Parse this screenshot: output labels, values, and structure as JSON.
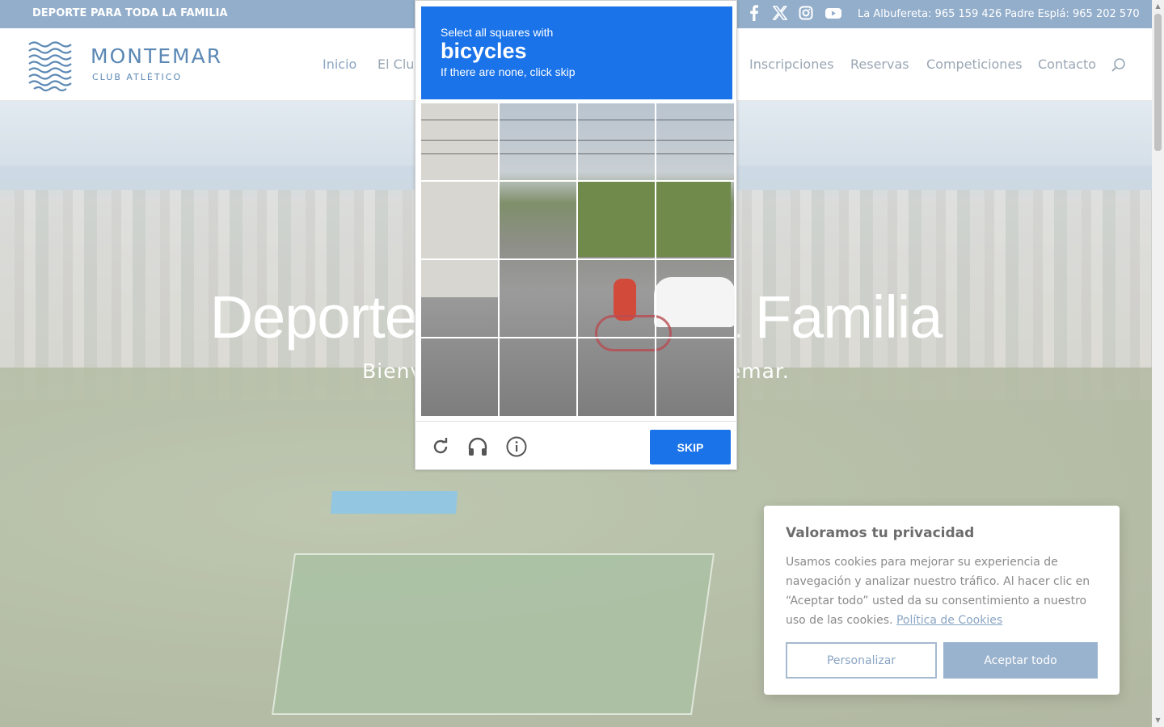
{
  "topbar": {
    "tagline": "DEPORTE PARA TODA LA FAMILIA",
    "social_icons": [
      "facebook-icon",
      "x-icon",
      "instagram-icon",
      "youtube-icon"
    ],
    "contact_1": "La Albufereta: 965 159 426",
    "contact_2": "Padre Esplá: 965 202 570"
  },
  "header": {
    "brand": "MONTEMAR",
    "brand_sub": "CLUB ATLÉTICO",
    "nav": {
      "inicio": "Inicio",
      "el_club": "El Club",
      "inscripciones": "Inscripciones",
      "reservas": "Reservas",
      "competiciones": "Competiciones",
      "contacto": "Contacto"
    },
    "search_icon": "search-icon"
  },
  "hero": {
    "title": "Deporte para toda la Familia",
    "subtitle": "Bienvenidos al Club Atlético Montemar."
  },
  "captcha": {
    "line1": "Select all squares with",
    "target": "bicycles",
    "line3": "If there are none, click skip",
    "skip_label": "SKIP",
    "icons": [
      "reload-icon",
      "headphones-icon",
      "info-icon"
    ],
    "accent": "#1a73e8"
  },
  "cookie": {
    "title": "Valoramos tu privacidad",
    "text": "Usamos cookies para mejorar su experiencia de navegación y analizar nuestro tráfico. Al hacer clic en “Aceptar todo” usted da su consentimiento a nuestro uso de las cookies.",
    "policy_link": "Política de Cookies",
    "customize": "Personalizar",
    "accept": "Aceptar todo"
  },
  "colors": {
    "topbar": "#93aecb",
    "brand": "#5b88b5",
    "nav_text": "#9aa7b4"
  }
}
